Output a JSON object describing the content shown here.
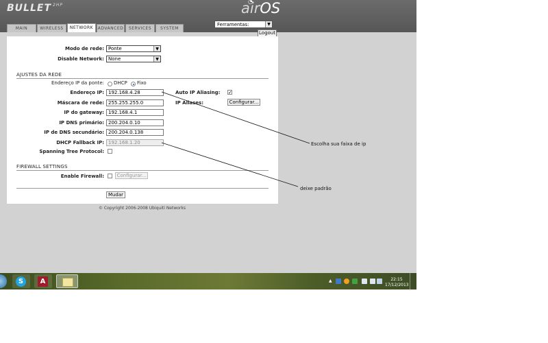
{
  "header": {
    "brand": "BULLET",
    "brand_sub": "2HP",
    "product_air": "air",
    "product_os": "OS",
    "tools_select": "Ferramentas:",
    "logout": "Logout"
  },
  "tabs": [
    {
      "label": "MAIN"
    },
    {
      "label": "WIRELESS"
    },
    {
      "label": "NETWORK",
      "active": true
    },
    {
      "label": "ADVANCED"
    },
    {
      "label": "SERVICES"
    },
    {
      "label": "SYSTEM"
    }
  ],
  "form": {
    "network_mode": {
      "label": "Modo de rede:",
      "value": "Ponte"
    },
    "disable_network": {
      "label": "Disable Network:",
      "value": "None"
    },
    "section_bridge": "AJUSTES DA REDE",
    "bridge_ip": {
      "label": "Endereço IP da ponte:",
      "options": [
        "DHCP",
        "Fixo"
      ],
      "selected": "Fixo"
    },
    "ip_address": {
      "label": "Endereço IP:",
      "value": "192.168.4.28"
    },
    "netmask": {
      "label": "Máscara de rede:",
      "value": "255.255.255.0"
    },
    "gateway": {
      "label": "IP do gateway:",
      "value": "192.168.4.1"
    },
    "dns1": {
      "label": "IP DNS primário:",
      "value": "200.204.0.10"
    },
    "dns2": {
      "label": "IP de DNS secundário:",
      "value": "200.204.0.138"
    },
    "dhcp_fallback": {
      "label": "DHCP Fallback IP:",
      "value": "192.168.1.20"
    },
    "stp": {
      "label": "Spanning Tree Protocol:",
      "checked": false
    },
    "auto_ip_alias": {
      "label": "Auto IP Aliasing:",
      "checked": true
    },
    "ip_aliases": {
      "label": "IP Aliases:",
      "button": "Configurar..."
    },
    "section_firewall": "FIREWALL SETTINGS",
    "enable_firewall": {
      "label": "Enable Firewall:",
      "checked": false,
      "button": "Configurar..."
    },
    "submit": "Mudar"
  },
  "footer": {
    "copyright": "© Copyright 2006-2008 Ubiquiti Networks"
  },
  "annotations": {
    "ip_range": "Escolha sua faixa de ip",
    "default": "deixe padrão"
  },
  "taskbar": {
    "time": "22:15",
    "date": "17/12/2013"
  },
  "colors": {
    "header": "#5f5f5f",
    "page_bg": "#d2d2d2",
    "panel": "#ffffff"
  }
}
